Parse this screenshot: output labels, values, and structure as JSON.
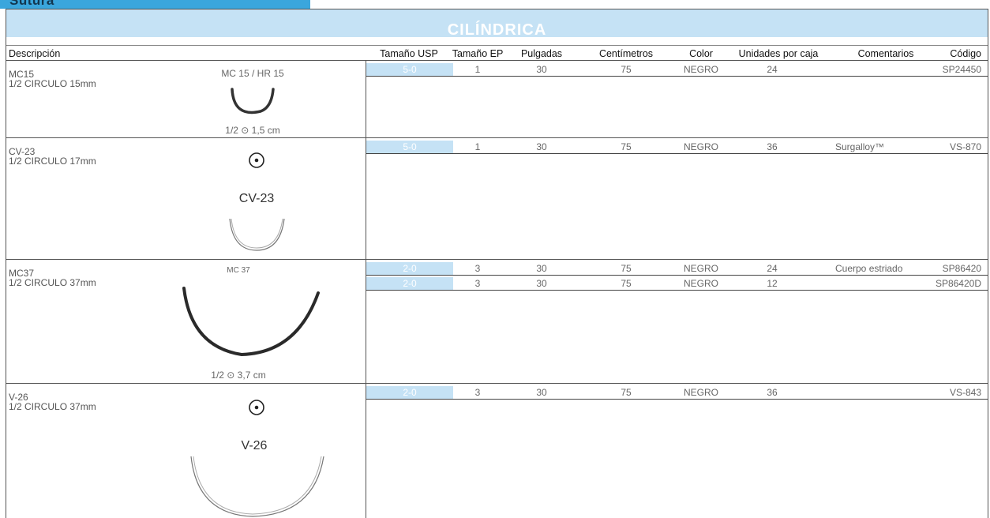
{
  "tab": {
    "label": "Sutura"
  },
  "section_title": "CILÍNDRICA",
  "headers": {
    "descripcion": "Descripción",
    "tamano_usp": "Tamaño USP",
    "tamano_ep": "Tamaño EP",
    "pulgadas": "Pulgadas",
    "centimetros": "Centímetros",
    "color": "Color",
    "unidades": "Unidades por caja",
    "comentarios": "Comentarios",
    "codigo": "Código"
  },
  "products": [
    {
      "code": "MC15",
      "desc": "1/2 CIRCULO 15mm",
      "image_top": "MC 15 / HR 15",
      "image_bottom": "1/2 ⊙ 1,5 cm",
      "rows": [
        {
          "usp": "5-0",
          "ep": "1",
          "pulgadas": "30",
          "cm": "75",
          "color": "NEGRO",
          "unidades": "24",
          "comentarios": "",
          "codigo": "SP24450"
        }
      ]
    },
    {
      "code": "CV-23",
      "desc": "1/2 CIRCULO 17mm",
      "image_top": "CV-23",
      "image_bottom": "",
      "rows": [
        {
          "usp": "5-0",
          "ep": "1",
          "pulgadas": "30",
          "cm": "75",
          "color": "NEGRO",
          "unidades": "36",
          "comentarios": "Surgalloy™",
          "codigo": "VS-870"
        }
      ]
    },
    {
      "code": "MC37",
      "desc": "1/2 CIRCULO 37mm",
      "image_top": "MC 37",
      "image_bottom": "1/2 ⊙ 3,7 cm",
      "rows": [
        {
          "usp": "2-0",
          "ep": "3",
          "pulgadas": "30",
          "cm": "75",
          "color": "NEGRO",
          "unidades": "24",
          "comentarios": "Cuerpo estriado",
          "codigo": "SP86420"
        },
        {
          "usp": "2-0",
          "ep": "3",
          "pulgadas": "30",
          "cm": "75",
          "color": "NEGRO",
          "unidades": "12",
          "comentarios": "",
          "codigo": "SP86420D"
        }
      ]
    },
    {
      "code": "V-26",
      "desc": "1/2 CIRCULO 37mm",
      "image_top": "V-26",
      "image_bottom": "",
      "rows": [
        {
          "usp": "2-0",
          "ep": "3",
          "pulgadas": "30",
          "cm": "75",
          "color": "NEGRO",
          "unidades": "36",
          "comentarios": "",
          "codigo": "VS-843"
        }
      ]
    }
  ]
}
